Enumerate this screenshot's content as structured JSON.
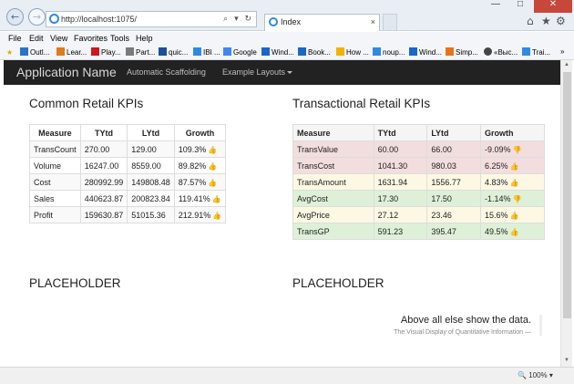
{
  "browser": {
    "address": "http://localhost:1075/",
    "address_controls": "⌕ ▾ ↻",
    "tab_title": "Index",
    "tab_close": "×",
    "win_min": "—",
    "win_max": "□",
    "win_close": "✕",
    "home_icon": "⌂",
    "star_icon": "★",
    "gear_icon": "⚙",
    "back_icon": "←",
    "forward_icon": "→",
    "menu": [
      "File",
      "Edit",
      "View",
      "Favorites",
      "Tools",
      "Help"
    ],
    "favorites": [
      {
        "label": "Outl...",
        "color": "#2a73c9"
      },
      {
        "label": "Lear...",
        "color": "#e07a1e"
      },
      {
        "label": "Play...",
        "color": "#cc181e"
      },
      {
        "label": "Part...",
        "color": "#7a7a7a"
      },
      {
        "label": "quic...",
        "color": "#1d4e9b"
      },
      {
        "label": "IBI ...",
        "color": "#2f8be0"
      },
      {
        "label": "Google",
        "color": "#4285f4"
      },
      {
        "label": "Wind...",
        "color": "#1b66c9"
      },
      {
        "label": "Book...",
        "color": "#1b66c9"
      },
      {
        "label": "How ...",
        "color": "#f0b400"
      },
      {
        "label": "noup...",
        "color": "#2f8be0"
      },
      {
        "label": "Wind...",
        "color": "#1b66c9"
      },
      {
        "label": "Simp...",
        "color": "#e8731c"
      },
      {
        "label": "«Выс...",
        "color": "#444444"
      },
      {
        "label": "Trai...",
        "color": "#2f8be0"
      }
    ],
    "favorites_more": "»",
    "zoom": "100%"
  },
  "app": {
    "brand": "Application Name",
    "nav": [
      "Automatic Scaffolding",
      "Example Layouts"
    ]
  },
  "common": {
    "title": "Common Retail KPIs",
    "columns": [
      "Measure",
      "TYtd",
      "LYtd",
      "Growth"
    ],
    "rows": [
      {
        "measure": "TransCount",
        "tytd": "270.00",
        "lytd": "129.00",
        "growth": "109.3%"
      },
      {
        "measure": "Volume",
        "tytd": "16247.00",
        "lytd": "8559.00",
        "growth": "89.82%"
      },
      {
        "measure": "Cost",
        "tytd": "280992.99",
        "lytd": "149808.48",
        "growth": "87.57%"
      },
      {
        "measure": "Sales",
        "tytd": "440623.87",
        "lytd": "200823.84",
        "growth": "119.41%"
      },
      {
        "measure": "Profit",
        "tytd": "159630.87",
        "lytd": "51015.36",
        "growth": "212.91%"
      }
    ]
  },
  "transactional": {
    "title": "Transactional Retail KPIs",
    "columns": [
      "Measure",
      "TYtd",
      "LYtd",
      "Growth"
    ],
    "rows": [
      {
        "measure": "TransValue",
        "tytd": "60.00",
        "lytd": "66.00",
        "growth": "-9.09%",
        "status": "danger",
        "thumb": "down"
      },
      {
        "measure": "TransCost",
        "tytd": "1041.30",
        "lytd": "980.03",
        "growth": "6.25%",
        "status": "danger",
        "thumb": "up"
      },
      {
        "measure": "TransAmount",
        "tytd": "1631.94",
        "lytd": "1556.77",
        "growth": "4.83%",
        "status": "warning",
        "thumb": "up"
      },
      {
        "measure": "AvgCost",
        "tytd": "17.30",
        "lytd": "17.50",
        "growth": "-1.14%",
        "status": "success",
        "thumb": "down"
      },
      {
        "measure": "AvgPrice",
        "tytd": "27.12",
        "lytd": "23.46",
        "growth": "15.6%",
        "status": "warning",
        "thumb": "up"
      },
      {
        "measure": "TransGP",
        "tytd": "591.23",
        "lytd": "395.47",
        "growth": "49.5%",
        "status": "success",
        "thumb": "up"
      }
    ]
  },
  "placeholders": [
    "PLACEHOLDER",
    "PLACEHOLDER"
  ],
  "quote": {
    "text": "Above all else show the data.",
    "source": "The Visual Display of Quantitative Information —"
  },
  "icons": {
    "thumb_up": "👍",
    "thumb_down": "👎"
  }
}
